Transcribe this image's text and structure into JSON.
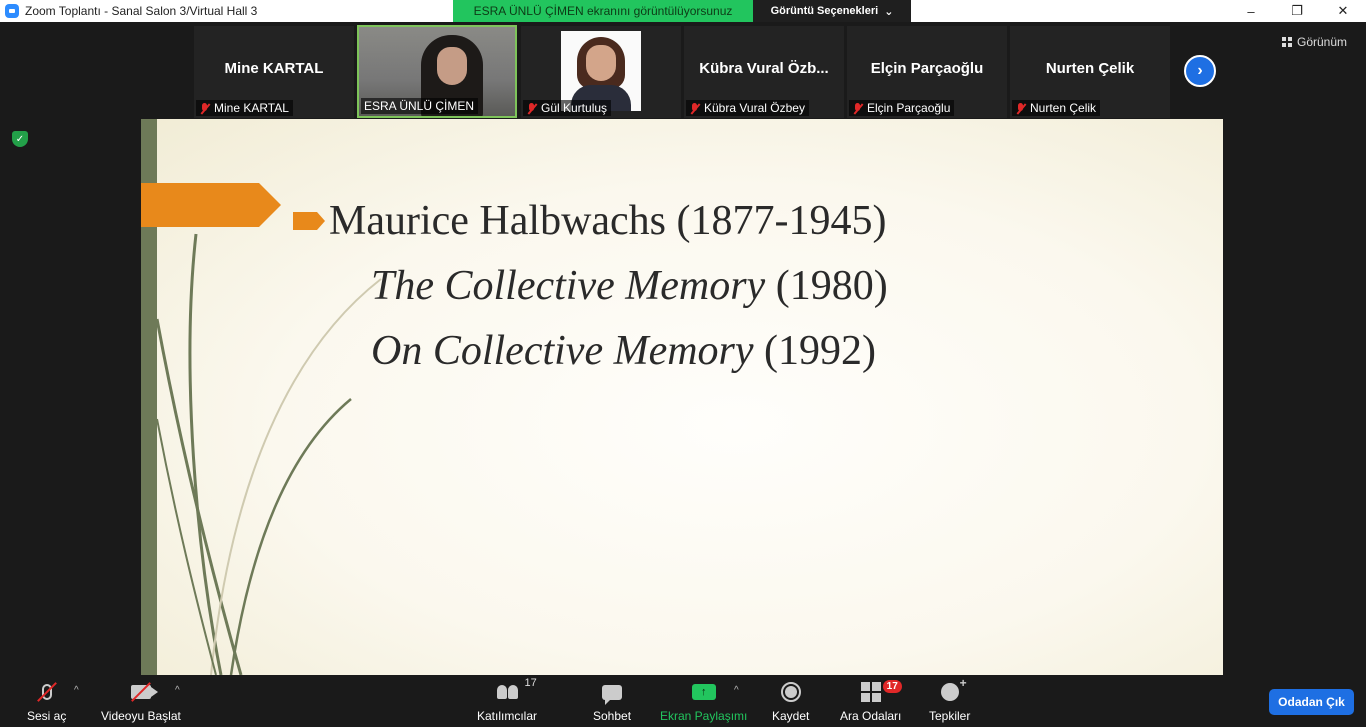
{
  "window": {
    "title": "Zoom Toplantı - Sanal Salon 3/Virtual Hall 3",
    "controls": [
      "–",
      "❐",
      "✕"
    ]
  },
  "share_banner": {
    "text": "ESRA ÜNLÜ ÇİMEN ekranını görüntülüyorsunuz",
    "view_options_label": "Görüntü Seçenekleri",
    "view_options_caret": "⌄"
  },
  "gallery": {
    "view_label": "Görünüm",
    "next_arrow": "›",
    "participants": [
      {
        "display_name": "Mine KARTAL",
        "label": "Mine KARTAL",
        "muted": true,
        "video": false
      },
      {
        "display_name": "",
        "label": "ESRA ÜNLÜ ÇİMEN",
        "muted": false,
        "video": true,
        "active": true
      },
      {
        "display_name": "",
        "label": "Gül Kurtuluş",
        "muted": true,
        "video": false,
        "photo": true
      },
      {
        "display_name": "Kübra Vural Özb...",
        "label": "Kübra Vural Özbey",
        "muted": true,
        "video": false
      },
      {
        "display_name": "Elçin Parçaoğlu",
        "label": "Elçin Parçaoğlu",
        "muted": true,
        "video": false
      },
      {
        "display_name": "Nurten Çelik",
        "label": "Nurten Çelik",
        "muted": true,
        "video": false
      }
    ]
  },
  "slide": {
    "title": "Maurice Halbwachs (1877-1945)",
    "lines": [
      {
        "italic": "The Collective Memory",
        "plain": " (1980)"
      },
      {
        "italic": "On Collective Memory",
        "plain": " (1992)"
      }
    ]
  },
  "toolbar": {
    "mute_label": "Sesi aç",
    "video_label": "Videoyu Başlat",
    "participants_label": "Katılımcılar",
    "participants_count": "17",
    "chat_label": "Sohbet",
    "share_label": "Ekran Paylaşımı",
    "share_icon": "↑",
    "record_label": "Kaydet",
    "rooms_label": "Ara Odaları",
    "rooms_badge": "17",
    "reactions_label": "Tepkiler",
    "leave_label": "Odadan Çık",
    "caret": "^"
  },
  "colors": {
    "share_green": "#22c55e",
    "accent_blue": "#1e6fe3",
    "slide_orange": "#e8891b",
    "mute_red": "#e02828"
  }
}
